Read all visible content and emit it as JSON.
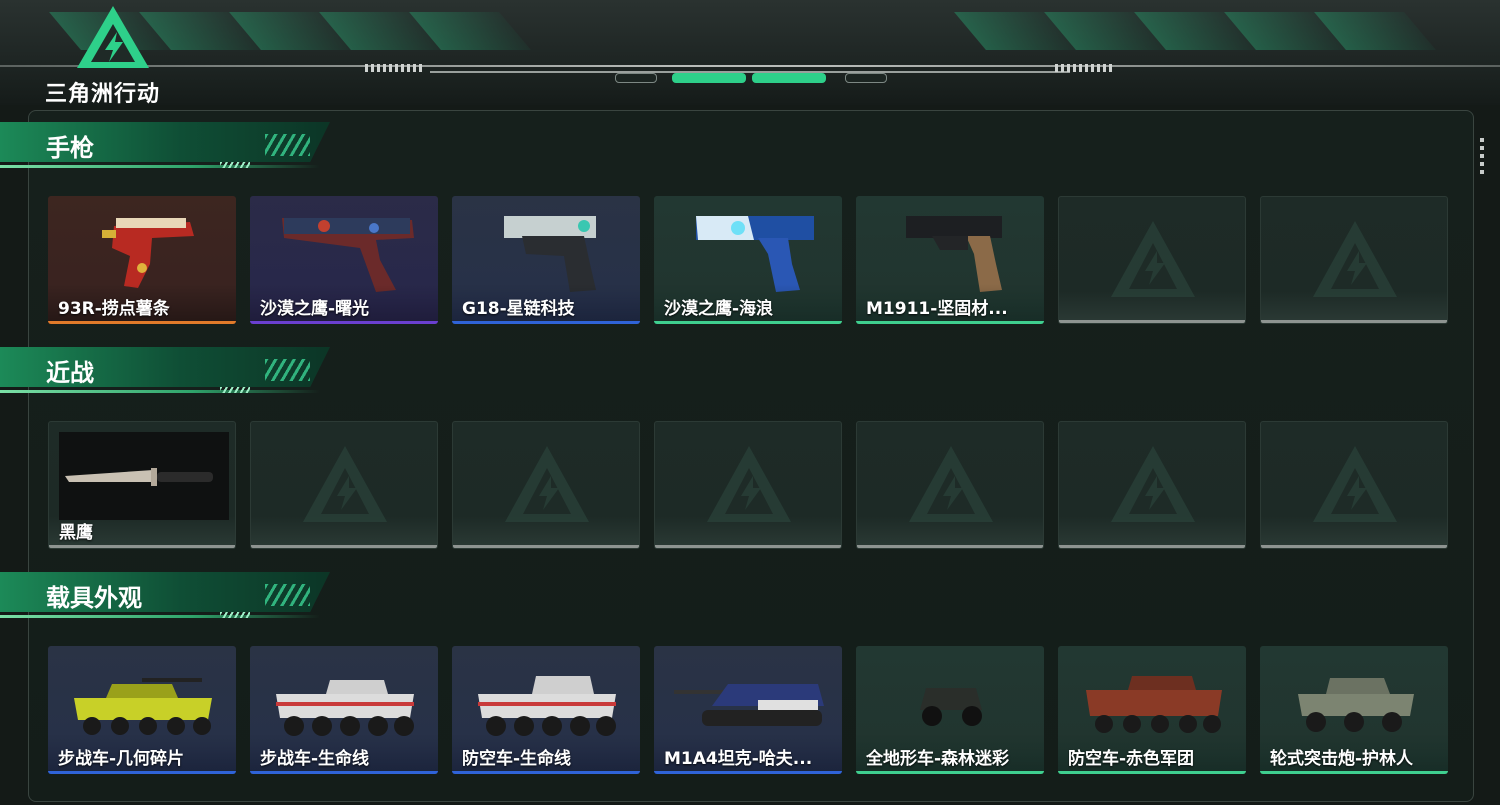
{
  "app": {
    "logo_text": "三角洲行动"
  },
  "colors": {
    "accent": "#2ed08a",
    "quality_gold": "#e07a2a",
    "quality_purple": "#6a3fd0",
    "quality_blue": "#2f63d8",
    "quality_green": "#3fcf8f",
    "empty": "#8e9491"
  },
  "sections": [
    {
      "title": "手枪",
      "items": [
        {
          "label": "93R-捞点薯条",
          "quality": "gold",
          "icon": "pistol-93r-icon"
        },
        {
          "label": "沙漠之鹰-曙光",
          "quality": "purple",
          "icon": "desert-eagle-icon"
        },
        {
          "label": "G18-星链科技",
          "quality": "blue",
          "icon": "pistol-g18-icon"
        },
        {
          "label": "沙漠之鹰-海浪",
          "quality": "green",
          "icon": "desert-eagle-icon"
        },
        {
          "label": "M1911-坚固材...",
          "quality": "green",
          "icon": "pistol-m1911-icon"
        },
        {
          "label": "",
          "quality": "empty",
          "icon": "delta-logo-icon"
        },
        {
          "label": "",
          "quality": "empty",
          "icon": "delta-logo-icon"
        }
      ]
    },
    {
      "title": "近战",
      "items": [
        {
          "label": "黑鹰",
          "quality": "empty",
          "icon": "knife-icon"
        },
        {
          "label": "",
          "quality": "empty",
          "icon": "delta-logo-icon"
        },
        {
          "label": "",
          "quality": "empty",
          "icon": "delta-logo-icon"
        },
        {
          "label": "",
          "quality": "empty",
          "icon": "delta-logo-icon"
        },
        {
          "label": "",
          "quality": "empty",
          "icon": "delta-logo-icon"
        },
        {
          "label": "",
          "quality": "empty",
          "icon": "delta-logo-icon"
        },
        {
          "label": "",
          "quality": "empty",
          "icon": "delta-logo-icon"
        }
      ]
    },
    {
      "title": "载具外观",
      "items": [
        {
          "label": "步战车-几何碎片",
          "quality": "blue",
          "icon": "ifv-icon"
        },
        {
          "label": "步战车-生命线",
          "quality": "blue",
          "icon": "ifv-icon"
        },
        {
          "label": "防空车-生命线",
          "quality": "blue",
          "icon": "aa-vehicle-icon"
        },
        {
          "label": "M1A4坦克-哈夫...",
          "quality": "green",
          "icon": "tank-icon"
        },
        {
          "label": "全地形车-森林迷彩",
          "quality": "green",
          "icon": "atv-icon"
        },
        {
          "label": "防空车-赤色军团",
          "quality": "green",
          "icon": "aa-vehicle-icon"
        },
        {
          "label": "轮式突击炮-护林人",
          "quality": "green",
          "icon": "assault-gun-icon"
        }
      ]
    }
  ]
}
